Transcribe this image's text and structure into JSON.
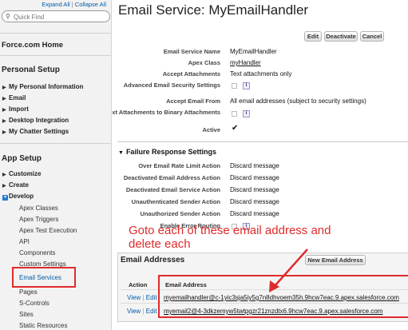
{
  "sidebar": {
    "expand_all": "Expand All",
    "sep": "|",
    "collapse_all": "Collapse All",
    "search_placeholder": "Quick Find",
    "home": "Force.com Home",
    "personal_setup": {
      "title": "Personal Setup",
      "items": [
        "My Personal Information",
        "Email",
        "Import",
        "Desktop Integration",
        "My Chatter Settings"
      ]
    },
    "app_setup": {
      "title": "App Setup",
      "items": [
        "Customize",
        "Create",
        "Develop"
      ],
      "develop_children": [
        "Apex Classes",
        "Apex Triggers",
        "Apex Test Execution",
        "API",
        "Components",
        "Custom Settings",
        "Email Services",
        "Pages",
        "S-Controls",
        "Sites",
        "Static Resources"
      ]
    }
  },
  "main": {
    "title": "Email Service: MyEmailHandler",
    "buttons": {
      "edit": "Edit",
      "deactivate": "Deactivate",
      "cancel": "Cancel"
    },
    "fields": [
      {
        "label": "Email Service Name",
        "value": "MyEmailHandler"
      },
      {
        "label": "Apex Class",
        "value": "myHandler"
      },
      {
        "label": "Accept Attachments",
        "value": "Text attachments only"
      },
      {
        "label": "Advanced Email Security Settings",
        "value": ""
      },
      {
        "label": "Accept Email From",
        "value": "All email addresses (subject to security settings)"
      },
      {
        "label": "Convert Text Attachments to Binary Attachments",
        "value": ""
      },
      {
        "label": "Active",
        "value": "✔"
      }
    ],
    "failure": {
      "title": "Failure Response Settings",
      "rows": [
        {
          "label": "Over Email Rate Limit Action",
          "value": "Discard message"
        },
        {
          "label": "Deactivated Email Address Action",
          "value": "Discard message"
        },
        {
          "label": "Deactivated Email Service Action",
          "value": "Discard message"
        },
        {
          "label": "Unauthenticated Sender Action",
          "value": "Discard message"
        },
        {
          "label": "Unauthorized Sender Action",
          "value": "Discard message"
        },
        {
          "label": "Enable Error Routing",
          "value": ""
        }
      ]
    },
    "email_addresses": {
      "title": "Email Addresses",
      "new_button": "New Email Address",
      "columns": [
        "Action",
        "Email Address"
      ],
      "rows": [
        {
          "view": "View",
          "edit": "Edit",
          "address": "myemailhandler@c-1yic3sja5iy5g7n8dhvoem35h.9hcw7eac.9.apex.salesforce.com"
        },
        {
          "view": "View",
          "edit": "Edit",
          "address": "myemail2@4-3dkzemyw5twtpgzr21znzdtx6.9hcw7eac.9.apex.salesforce.com"
        }
      ]
    }
  },
  "annotation": {
    "text": "Goto each of these email address and delete each"
  },
  "colors": {
    "annotation": "#e02b2b",
    "link": "#015ba7"
  }
}
